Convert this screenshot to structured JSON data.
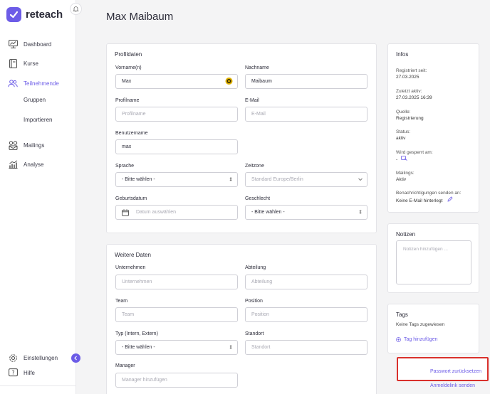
{
  "app": {
    "logo_text": "reteach"
  },
  "colors": {
    "accent": "#6c5ce7",
    "highlight": "#d9302c",
    "avatar_dot": "#e0b100"
  },
  "sidebar": {
    "items": [
      {
        "label": "Dashboard",
        "icon": "dashboard-icon"
      },
      {
        "label": "Kurse",
        "icon": "book-icon"
      },
      {
        "label": "Teilnehmende",
        "icon": "users-icon",
        "active": true
      },
      {
        "label": "Gruppen"
      },
      {
        "label": "Importieren"
      },
      {
        "label": "Mailings",
        "icon": "mailings-icon"
      },
      {
        "label": "Analyse",
        "icon": "analytics-icon"
      }
    ],
    "bottom": [
      {
        "label": "Einstellungen",
        "icon": "gear-icon"
      },
      {
        "label": "Hilfe",
        "icon": "help-icon"
      }
    ]
  },
  "page": {
    "title": "Max Maibaum"
  },
  "profile": {
    "title": "Profildaten",
    "firstname": {
      "label": "Vorname(n)",
      "value": "Max"
    },
    "lastname": {
      "label": "Nachname",
      "value": "Maibaum"
    },
    "profilename": {
      "label": "Profilname",
      "placeholder": "Profilname"
    },
    "email": {
      "label": "E-Mail",
      "placeholder": "E-Mail"
    },
    "username": {
      "label": "Benutzername",
      "value": "max"
    },
    "language": {
      "label": "Sprache",
      "value": "- Bitte wählen -"
    },
    "timezone": {
      "label": "Zeitzone",
      "placeholder": "Standard Europe/Berlin"
    },
    "birthdate": {
      "label": "Geburtsdatum",
      "placeholder": "Datum auswählen"
    },
    "gender": {
      "label": "Geschlecht",
      "value": "- Bitte wählen -"
    }
  },
  "more": {
    "title": "Weitere Daten",
    "company": {
      "label": "Unternehmen",
      "placeholder": "Unternehmen"
    },
    "department": {
      "label": "Abteilung",
      "placeholder": "Abteilung"
    },
    "team": {
      "label": "Team",
      "placeholder": "Team"
    },
    "position": {
      "label": "Position",
      "placeholder": "Position"
    },
    "type": {
      "label": "Typ (Intern, Extern)",
      "value": "- Bitte wählen -"
    },
    "location": {
      "label": "Standort",
      "placeholder": "Standort"
    },
    "manager": {
      "label": "Manager",
      "placeholder": "Manager hinzufügen"
    }
  },
  "info": {
    "title": "Infos",
    "registered": {
      "label": "Registriert seit:",
      "value": "27.03.2025"
    },
    "last_active": {
      "label": "Zuletzt aktiv:",
      "value": "27.03.2025 16:39"
    },
    "source": {
      "label": "Quelle:",
      "value": "Registrierung"
    },
    "status": {
      "label": "Status:",
      "value": "aktiv"
    },
    "locked": {
      "label": "Wird gesperrt am:",
      "value": "-"
    },
    "mailings": {
      "label": "Mailings:",
      "value": "Aktiv"
    },
    "notifications": {
      "label": "Benachrichtigungen senden an:",
      "value": "Keine E-Mail hinterlegt"
    }
  },
  "notes": {
    "title": "Notizen",
    "placeholder": "Notizen hinzufügen ..."
  },
  "tags": {
    "title": "Tags",
    "empty": "Keine Tags zugewiesen",
    "add": "Tag hinzufügen"
  },
  "actions": {
    "reset_password": "Passwort zurücksetzen",
    "send_login_link": "Anmeldelink senden"
  }
}
